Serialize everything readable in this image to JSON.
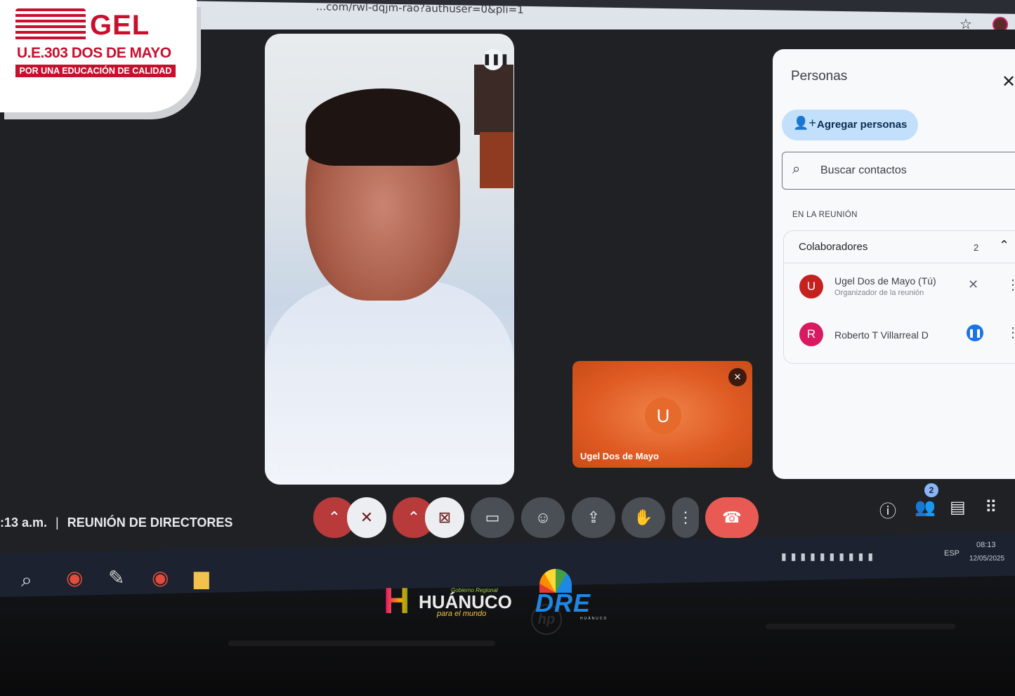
{
  "browser": {
    "url": "...com/rwl-dqjm-rao?authuser=0&pli=1"
  },
  "brand": {
    "ugel": "GEL",
    "unit": "U.E.303  DOS DE MAYO",
    "slogan": "POR UNA EDUCACIÓN DE CALIDAD"
  },
  "tiles": {
    "main_name": "Roberto T Villarreal D",
    "self_name": "Ugel Dos de Mayo",
    "self_initial": "U"
  },
  "people_panel": {
    "title": "Personas",
    "add_label": "Agregar personas",
    "search_placeholder": "Buscar contactos",
    "section": "EN LA REUNIÓN",
    "group_name": "Colaboradores",
    "group_count": "2",
    "participants": [
      {
        "initial": "U",
        "name": "Ugel Dos de Mayo (Tú)",
        "sub": "Organizador de la reunión",
        "color": "#c5221f"
      },
      {
        "initial": "R",
        "name": "Roberto T Villarreal D",
        "sub": "",
        "color": "#d81b60"
      }
    ]
  },
  "meeting": {
    "time": ":13 a.m.",
    "sep": "|",
    "title": "REUNIÓN DE DIRECTORES",
    "people_badge": "2"
  },
  "tray": {
    "lang": "ESP",
    "time": "08:13",
    "date": "12/05/2025"
  },
  "footer": {
    "gov": "Gobierno Regional",
    "region": "HUÁNUCO",
    "tagline": "para el mundo",
    "dre": "DRE",
    "dre_sub": "HUÁNUCO",
    "hp": "hp"
  }
}
